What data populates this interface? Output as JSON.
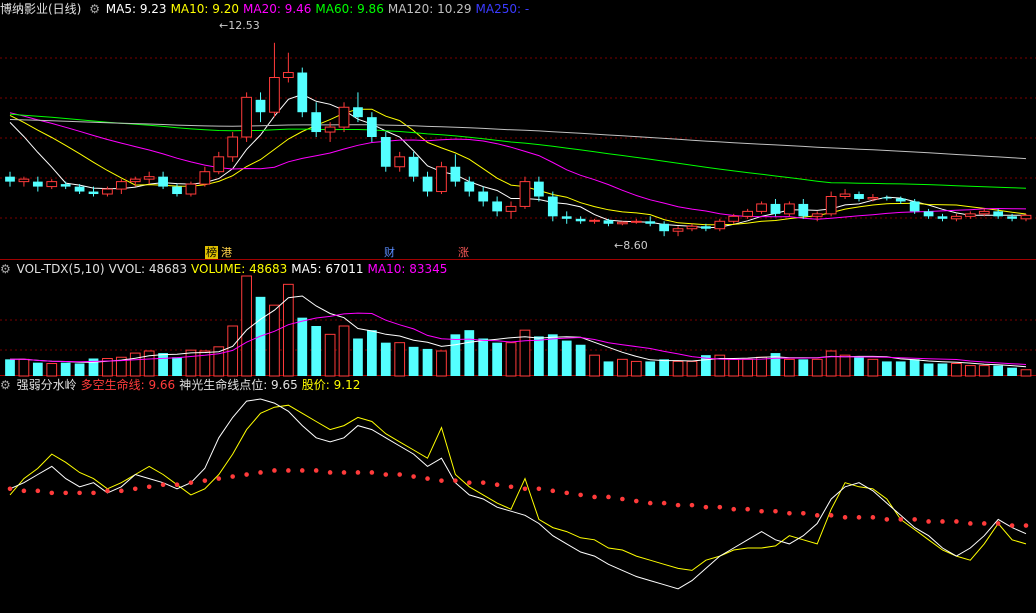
{
  "colors": {
    "background": "#000000",
    "up": "#ff3b3b",
    "down": "#54ffff",
    "ma5": "#ffffff",
    "ma10": "#ffff00",
    "ma20": "#ff00ff",
    "ma60": "#00ff00",
    "ma120": "#c0c0c0",
    "ma250": "#3b3bff",
    "grid": "#7a0000",
    "divider": "#a00000",
    "header_text": "#e0e0e0",
    "price_value": "#ffff00"
  },
  "price_panel": {
    "title": "博纳影业(日线)",
    "legend": [
      {
        "text": "MA5: 9.23",
        "color": "#ffffff"
      },
      {
        "text": "MA10: 9.20",
        "color": "#ffff00"
      },
      {
        "text": "MA20: 9.46",
        "color": "#ff00ff"
      },
      {
        "text": "MA60: 9.86",
        "color": "#00ff00"
      },
      {
        "text": "MA120: 10.29",
        "color": "#c0c0c0"
      },
      {
        "text": "MA250: -",
        "color": "#3b3bff"
      }
    ],
    "high_label": "12.53",
    "low_label": "8.60",
    "event_tags": [
      {
        "text": "榜",
        "bg": "#e0c000",
        "fg": "#000000"
      },
      {
        "text": "港",
        "bg": "#000000",
        "fg": "#ffd24a"
      },
      {
        "text": "财",
        "bg": "#000000",
        "fg": "#5a8cff"
      },
      {
        "text": "涨",
        "bg": "#000000",
        "fg": "#ff5a5a"
      }
    ]
  },
  "volume_panel": {
    "legend": [
      {
        "text": "VOL-TDX(5,10)",
        "color": "#e0e0e0"
      },
      {
        "text": "VVOL: 48683",
        "color": "#e0e0e0"
      },
      {
        "text": "VOLUME: 48683",
        "color": "#ffff00"
      },
      {
        "text": "MA5: 67011",
        "color": "#ffffff"
      },
      {
        "text": "MA10: 83345",
        "color": "#ff00ff"
      }
    ]
  },
  "indicator_panel": {
    "legend": [
      {
        "text": "强弱分水岭",
        "color": "#e0e0e0"
      },
      {
        "text": "多空生命线: 9.66",
        "color": "#ff3b3b"
      },
      {
        "text": "神光生命线点位: 9.65",
        "color": "#e0e0e0"
      },
      {
        "text": "股价: 9.12",
        "color": "#ffff00"
      }
    ]
  },
  "chart_data": [
    {
      "type": "candlestick",
      "ylim": [
        8.2,
        13.0
      ],
      "candles": [
        [
          9.8,
          9.9,
          9.6,
          9.7
        ],
        [
          9.7,
          9.8,
          9.6,
          9.75
        ],
        [
          9.7,
          9.8,
          9.5,
          9.6
        ],
        [
          9.6,
          9.75,
          9.55,
          9.7
        ],
        [
          9.65,
          9.7,
          9.55,
          9.6
        ],
        [
          9.6,
          9.65,
          9.45,
          9.5
        ],
        [
          9.5,
          9.6,
          9.4,
          9.45
        ],
        [
          9.45,
          9.6,
          9.4,
          9.55
        ],
        [
          9.55,
          9.75,
          9.45,
          9.7
        ],
        [
          9.7,
          9.8,
          9.6,
          9.75
        ],
        [
          9.75,
          9.9,
          9.65,
          9.8
        ],
        [
          9.8,
          9.9,
          9.55,
          9.6
        ],
        [
          9.6,
          9.65,
          9.4,
          9.45
        ],
        [
          9.45,
          9.7,
          9.4,
          9.65
        ],
        [
          9.65,
          10.0,
          9.6,
          9.9
        ],
        [
          9.9,
          10.3,
          9.85,
          10.2
        ],
        [
          10.2,
          10.7,
          10.1,
          10.6
        ],
        [
          10.6,
          11.5,
          10.5,
          11.4
        ],
        [
          11.35,
          11.5,
          10.9,
          11.1
        ],
        [
          11.1,
          12.5,
          11.0,
          11.8
        ],
        [
          11.8,
          12.3,
          11.7,
          11.9
        ],
        [
          11.9,
          12.0,
          11.0,
          11.1
        ],
        [
          11.1,
          11.3,
          10.6,
          10.7
        ],
        [
          10.7,
          10.9,
          10.5,
          10.8
        ],
        [
          10.8,
          11.3,
          10.7,
          11.2
        ],
        [
          11.2,
          11.5,
          10.9,
          11.0
        ],
        [
          11.0,
          11.1,
          10.5,
          10.6
        ],
        [
          10.6,
          10.7,
          9.9,
          10.0
        ],
        [
          10.0,
          10.3,
          9.9,
          10.2
        ],
        [
          10.2,
          10.3,
          9.7,
          9.8
        ],
        [
          9.8,
          9.9,
          9.4,
          9.5
        ],
        [
          9.5,
          10.1,
          9.45,
          10.0
        ],
        [
          10.0,
          10.25,
          9.6,
          9.7
        ],
        [
          9.7,
          9.8,
          9.4,
          9.5
        ],
        [
          9.5,
          9.6,
          9.2,
          9.3
        ],
        [
          9.3,
          9.4,
          9.0,
          9.1
        ],
        [
          9.1,
          9.3,
          8.95,
          9.2
        ],
        [
          9.2,
          9.8,
          9.15,
          9.7
        ],
        [
          9.7,
          9.8,
          9.3,
          9.4
        ],
        [
          9.4,
          9.5,
          8.9,
          9.0
        ],
        [
          9.0,
          9.1,
          8.85,
          8.95
        ],
        [
          8.95,
          9.0,
          8.85,
          8.9
        ],
        [
          8.9,
          8.95,
          8.85,
          8.92
        ],
        [
          8.92,
          8.95,
          8.8,
          8.85
        ],
        [
          8.85,
          8.9,
          8.82,
          8.88
        ],
        [
          8.88,
          8.95,
          8.85,
          8.9
        ],
        [
          8.9,
          9.0,
          8.8,
          8.85
        ],
        [
          8.85,
          8.9,
          8.6,
          8.7
        ],
        [
          8.7,
          8.8,
          8.6,
          8.75
        ],
        [
          8.75,
          8.85,
          8.7,
          8.8
        ],
        [
          8.8,
          8.85,
          8.7,
          8.75
        ],
        [
          8.75,
          8.95,
          8.7,
          8.9
        ],
        [
          8.9,
          9.05,
          8.85,
          9.0
        ],
        [
          9.0,
          9.15,
          8.95,
          9.1
        ],
        [
          9.1,
          9.3,
          9.05,
          9.25
        ],
        [
          9.25,
          9.35,
          9.0,
          9.05
        ],
        [
          9.05,
          9.3,
          9.0,
          9.25
        ],
        [
          9.25,
          9.35,
          8.95,
          9.0
        ],
        [
          9.0,
          9.1,
          8.9,
          9.05
        ],
        [
          9.05,
          9.5,
          9.0,
          9.4
        ],
        [
          9.4,
          9.55,
          9.35,
          9.45
        ],
        [
          9.45,
          9.5,
          9.3,
          9.35
        ],
        [
          9.35,
          9.45,
          9.3,
          9.38
        ],
        [
          9.38,
          9.42,
          9.32,
          9.36
        ],
        [
          9.36,
          9.4,
          9.25,
          9.3
        ],
        [
          9.3,
          9.35,
          9.05,
          9.1
        ],
        [
          9.1,
          9.15,
          8.95,
          9.0
        ],
        [
          9.0,
          9.05,
          8.9,
          8.95
        ],
        [
          8.95,
          9.05,
          8.9,
          9.0
        ],
        [
          9.0,
          9.1,
          8.95,
          9.05
        ],
        [
          9.05,
          9.15,
          9.0,
          9.1
        ],
        [
          9.1,
          9.15,
          8.95,
          9.0
        ],
        [
          9.0,
          9.05,
          8.9,
          8.95
        ],
        [
          8.95,
          9.05,
          8.9,
          9.02
        ]
      ],
      "ma_periods": [
        5,
        10,
        20,
        60,
        120
      ]
    },
    {
      "type": "bar",
      "volumes": [
        40,
        40,
        32,
        30,
        32,
        30,
        42,
        42,
        45,
        55,
        60,
        55,
        45,
        62,
        60,
        70,
        120,
        240,
        190,
        170,
        220,
        140,
        120,
        100,
        120,
        90,
        110,
        80,
        80,
        70,
        65,
        60,
        100,
        110,
        90,
        80,
        80,
        110,
        95,
        100,
        85,
        75,
        50,
        35,
        40,
        35,
        35,
        40,
        35,
        35,
        50,
        50,
        40,
        40,
        45,
        55,
        40,
        40,
        40,
        60,
        50,
        45,
        40,
        35,
        35,
        40,
        30,
        30,
        30,
        25,
        25,
        25,
        20,
        15
      ],
      "ma_periods": [
        5,
        10
      ]
    },
    {
      "type": "line",
      "ylim": [
        0,
        1
      ],
      "series": [
        {
          "values": [
            0.52,
            0.6,
            0.65,
            0.72,
            0.68,
            0.63,
            0.6,
            0.55,
            0.58,
            0.62,
            0.66,
            0.62,
            0.57,
            0.52,
            0.55,
            0.62,
            0.72,
            0.84,
            0.92,
            0.95,
            0.96,
            0.92,
            0.88,
            0.84,
            0.86,
            0.9,
            0.88,
            0.82,
            0.78,
            0.74,
            0.7,
            0.85,
            0.62,
            0.56,
            0.52,
            0.48,
            0.45,
            0.6,
            0.4,
            0.36,
            0.34,
            0.31,
            0.3,
            0.26,
            0.25,
            0.22,
            0.2,
            0.18,
            0.16,
            0.15,
            0.2,
            0.22,
            0.25,
            0.26,
            0.26,
            0.27,
            0.32,
            0.3,
            0.28,
            0.45,
            0.58,
            0.56,
            0.55,
            0.5,
            0.4,
            0.35,
            0.3,
            0.25,
            0.22,
            0.2,
            0.28,
            0.38,
            0.3,
            0.28
          ],
          "color": "#ffff00"
        },
        {
          "values": [
            0.55,
            0.58,
            0.62,
            0.66,
            0.6,
            0.56,
            0.58,
            0.53,
            0.56,
            0.62,
            0.6,
            0.58,
            0.55,
            0.58,
            0.65,
            0.8,
            0.9,
            0.98,
            0.99,
            0.97,
            0.93,
            0.86,
            0.8,
            0.78,
            0.8,
            0.86,
            0.84,
            0.8,
            0.76,
            0.72,
            0.66,
            0.7,
            0.58,
            0.52,
            0.5,
            0.46,
            0.44,
            0.42,
            0.38,
            0.32,
            0.28,
            0.24,
            0.22,
            0.18,
            0.15,
            0.12,
            0.1,
            0.08,
            0.06,
            0.1,
            0.16,
            0.22,
            0.26,
            0.3,
            0.34,
            0.3,
            0.28,
            0.32,
            0.38,
            0.5,
            0.56,
            0.58,
            0.54,
            0.48,
            0.42,
            0.36,
            0.32,
            0.26,
            0.22,
            0.26,
            0.32,
            0.4,
            0.36,
            0.33
          ],
          "color": "#ffffff"
        },
        {
          "values": [
            0.55,
            0.54,
            0.54,
            0.53,
            0.53,
            0.53,
            0.53,
            0.54,
            0.54,
            0.55,
            0.56,
            0.57,
            0.57,
            0.58,
            0.59,
            0.6,
            0.61,
            0.62,
            0.63,
            0.64,
            0.64,
            0.64,
            0.64,
            0.63,
            0.63,
            0.63,
            0.63,
            0.62,
            0.62,
            0.61,
            0.6,
            0.59,
            0.59,
            0.58,
            0.58,
            0.57,
            0.56,
            0.55,
            0.55,
            0.54,
            0.53,
            0.52,
            0.51,
            0.51,
            0.5,
            0.49,
            0.48,
            0.48,
            0.47,
            0.47,
            0.46,
            0.46,
            0.45,
            0.45,
            0.44,
            0.44,
            0.43,
            0.43,
            0.42,
            0.42,
            0.41,
            0.41,
            0.41,
            0.4,
            0.4,
            0.4,
            0.39,
            0.39,
            0.39,
            0.38,
            0.38,
            0.38,
            0.37,
            0.37
          ],
          "color": "#ff3b3b"
        }
      ]
    }
  ]
}
